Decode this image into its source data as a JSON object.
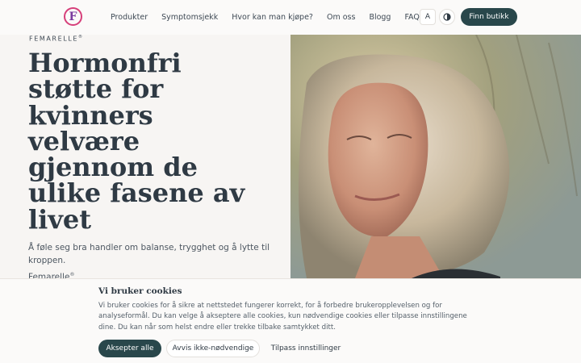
{
  "header": {
    "logo_letter": "F",
    "nav": [
      "Produkter",
      "Symptomsjekk",
      "Hvor kan man kjøpe?",
      "Om oss",
      "Blogg",
      "FAQ"
    ],
    "font_size_label": "A",
    "find_store_label": "Finn butikk"
  },
  "hero": {
    "brand": "FEMARELLE",
    "brand_mark": "®",
    "title": "Hormonfri støtte for kvinners velvære gjennom de ulike fasene av livet",
    "text": "Å føle seg bra handler om balanse, trygghet og å lytte til kroppen.",
    "text2": "Femarelle",
    "text2_mark": "®"
  },
  "cookie": {
    "title": "Vi bruker cookies",
    "text": "Vi bruker cookies for å sikre at nettstedet fungerer korrekt, for å forbedre brukeropplevelsen og for analyseformål. Du kan velge å akseptere alle cookies, kun nødvendige cookies eller tilpasse innstillingene dine. Du kan når som helst endre eller trekke tilbake samtykket ditt.",
    "accept_label": "Aksepter alle",
    "reject_label": "Avvis ikke-nødvendige",
    "customize_label": "Tilpass innstillinger"
  },
  "colors": {
    "primary": "#29474b",
    "logo_ring": "#d63f7a",
    "background": "#f7f5f3"
  },
  "icons": {
    "theme_toggle": "contrast-icon"
  }
}
